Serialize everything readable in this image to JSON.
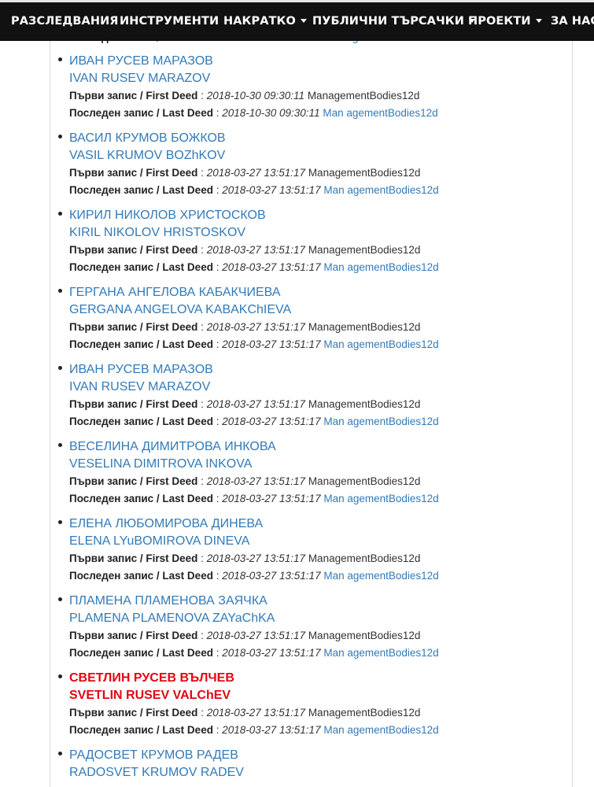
{
  "nav": {
    "items": [
      {
        "label": "РАЗСЛЕДВАНИЯ",
        "dropdown": false
      },
      {
        "label": "ИНСТРУМЕНТИ",
        "dropdown": false
      },
      {
        "label": "НАКРАТКО",
        "dropdown": true
      },
      {
        "label": "ПУБЛИЧНИ ТЪРСАЧКИ",
        "dropdown": true
      },
      {
        "label": "ПРОЕКТИ",
        "dropdown": true
      },
      {
        "label": "ЗА НАС",
        "dropdown": false
      }
    ]
  },
  "labels": {
    "first_deed": "Първи запис / First Deed",
    "last_deed": "Последен запис / Last Deed",
    "separator": " : "
  },
  "records": [
    {
      "name_bg": "ИВАН РУСЕВ МАРАЗОВ",
      "name_en": "IVAN RUSEV MARAZOV",
      "first_date": "2018-10-30 09:30:11",
      "first_source": "ManagementBodies12d",
      "last_date": "2018-10-30 09:30:11",
      "last_source": "Man agementBodies12d",
      "highlight": false
    },
    {
      "name_bg": "ВАСИЛ КРУМОВ БОЖКОВ",
      "name_en": "VASIL KRUMOV BOZhKOV",
      "first_date": "2018-03-27 13:51:17",
      "first_source": "ManagementBodies12d",
      "last_date": "2018-03-27 13:51:17",
      "last_source": "Man agementBodies12d",
      "highlight": false
    },
    {
      "name_bg": "КИРИЛ НИКОЛОВ ХРИСТОСКОВ",
      "name_en": "KIRIL NIKOLOV HRISTOSKOV",
      "first_date": "2018-03-27 13:51:17",
      "first_source": "ManagementBodies12d",
      "last_date": "2018-03-27 13:51:17",
      "last_source": "Man agementBodies12d",
      "highlight": false
    },
    {
      "name_bg": "ГЕРГАНА АНГЕЛОВА КАБАКЧИЕВА",
      "name_en": "GERGANA ANGELOVA KABAKChIEVA",
      "first_date": "2018-03-27 13:51:17",
      "first_source": "ManagementBodies12d",
      "last_date": "2018-03-27 13:51:17",
      "last_source": "Man agementBodies12d",
      "highlight": false
    },
    {
      "name_bg": "ИВАН РУСЕВ МАРАЗОВ",
      "name_en": "IVAN RUSEV MARAZOV",
      "first_date": "2018-03-27 13:51:17",
      "first_source": "ManagementBodies12d",
      "last_date": "2018-03-27 13:51:17",
      "last_source": "Man agementBodies12d",
      "highlight": false
    },
    {
      "name_bg": "ВЕСЕЛИНА ДИМИТРОВА ИНКОВА",
      "name_en": "VESELINA DIMITROVA INKOVA",
      "first_date": "2018-03-27 13:51:17",
      "first_source": "ManagementBodies12d",
      "last_date": "2018-03-27 13:51:17",
      "last_source": "Man agementBodies12d",
      "highlight": false
    },
    {
      "name_bg": "ЕЛЕНА ЛЮБОМИРОВА ДИНЕВА",
      "name_en": "ELENA LYuBOMIROVA DINEVA",
      "first_date": "2018-03-27 13:51:17",
      "first_source": "ManagementBodies12d",
      "last_date": "2018-03-27 13:51:17",
      "last_source": "Man agementBodies12d",
      "highlight": false
    },
    {
      "name_bg": "ПЛАМЕНА ПЛАМЕНОВА ЗАЯЧКА",
      "name_en": "PLAMENA PLAMENOVA ZAYaChKA",
      "first_date": "2018-03-27 13:51:17",
      "first_source": "ManagementBodies12d",
      "last_date": "2018-03-27 13:51:17",
      "last_source": "Man agementBodies12d",
      "highlight": false
    },
    {
      "name_bg": "СВЕТЛИН РУСЕВ ВЪЛЧЕВ",
      "name_en": "SVETLIN RUSEV VALChEV",
      "first_date": "2018-03-27 13:51:17",
      "first_source": "ManagementBodies12d",
      "last_date": "2018-03-27 13:51:17",
      "last_source": "Man agementBodies12d",
      "highlight": true
    },
    {
      "name_bg": "РАДОСВЕТ КРУМОВ РАДЕВ",
      "name_en": "RADOSVET KRUMOV RADEV",
      "first_date": "",
      "first_source": "",
      "last_date": "",
      "last_source": "",
      "highlight": false
    }
  ],
  "colors": {
    "link": "#337ab7",
    "highlight": "#e30613",
    "navbar_bg": "#111111"
  }
}
